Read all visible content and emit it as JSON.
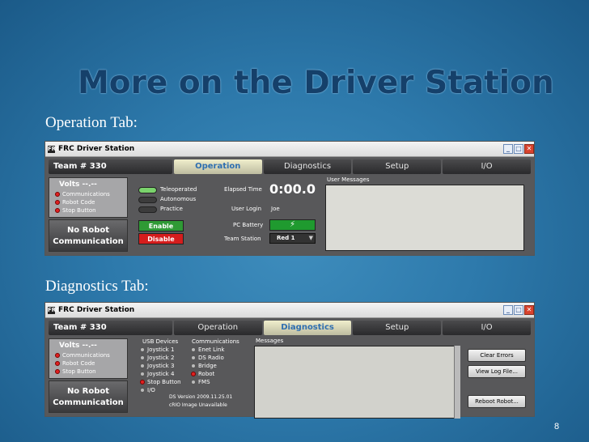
{
  "slide": {
    "title": "More on the Driver Station",
    "page_number": "8"
  },
  "sections": {
    "operation_label": "Operation Tab:",
    "diagnostics_label": "Diagnostics Tab:"
  },
  "window": {
    "title": "FRC Driver Station",
    "app_icon": "FRC",
    "minimize_glyph": "_",
    "maximize_glyph": "□",
    "close_glyph": "✕"
  },
  "tabs": {
    "team": "Team #  330",
    "operation": "Operation",
    "diagnostics": "Diagnostics",
    "setup": "Setup",
    "io": "I/O"
  },
  "status": {
    "volts": "Volts  --.--",
    "communications": "Communications",
    "robot_code": "Robot Code",
    "stop_button": "Stop Button",
    "no_robot_line1": "No Robot",
    "no_robot_line2": "Communication"
  },
  "operation": {
    "modes": [
      "Teleoperated",
      "Autonomous",
      "Practice"
    ],
    "enable": "Enable",
    "disable": "Disable",
    "elapsed_time_label": "Elapsed Time",
    "elapsed_time_value": "0:00.0",
    "user_login_label": "User Login",
    "user_login_value": "Joe",
    "pc_battery_label": "PC Battery",
    "team_station_label": "Team Station",
    "team_station_value": "Red 1",
    "user_messages_label": "User Messages"
  },
  "diagnostics": {
    "usb_devices_label": "USB Devices",
    "usb_devices": [
      "Joystick 1",
      "Joystick 2",
      "Joystick 3",
      "Joystick 4",
      "Stop Button",
      "I/O"
    ],
    "communications_label": "Communications",
    "communications": [
      "Enet Link",
      "DS Radio",
      "Bridge",
      "Robot",
      "FMS"
    ],
    "ds_version": "DS Version  2009.11.25.01",
    "crio_image": "cRIO Image   Unavailable",
    "messages_label": "Messages",
    "clear_errors": "Clear Errors",
    "view_log_file": "View Log File...",
    "reboot_robot": "Reboot Robot..."
  },
  "colors": {
    "enable": "#2f9a35",
    "disable": "#d51d1d",
    "active_tab_text": "#2f6fb0",
    "title": "#15406a"
  }
}
